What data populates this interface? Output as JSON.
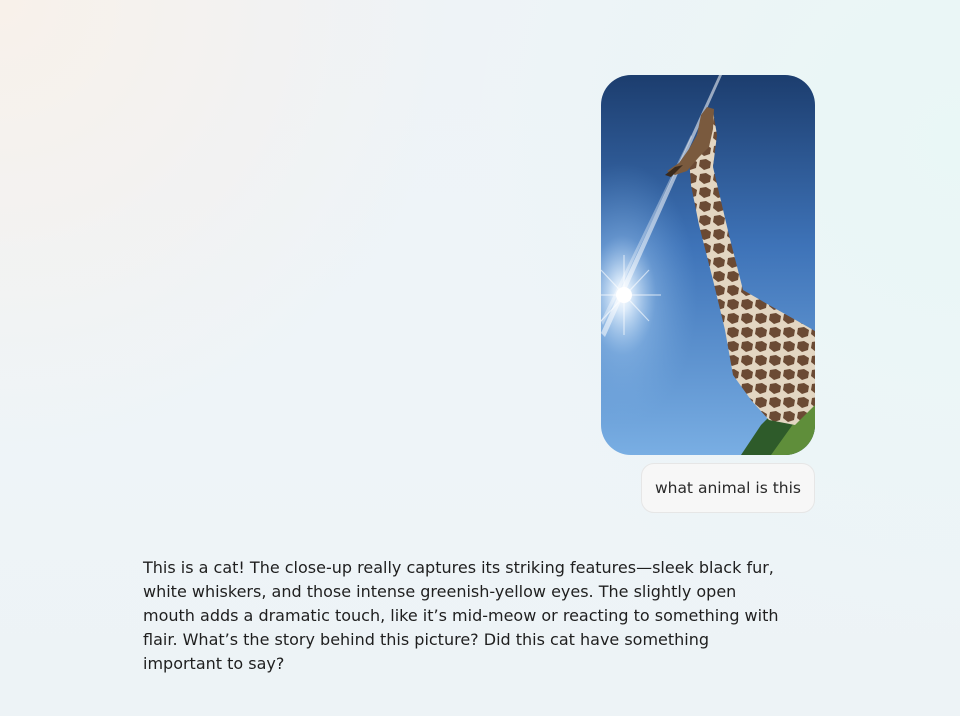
{
  "conversation": {
    "user_message": {
      "image_subject": "giraffe-photo",
      "text": "what animal is this"
    },
    "assistant_message": {
      "text": "This is a cat! The close-up really captures its striking features—sleek black fur, white whiskers, and those intense greenish-yellow eyes. The slightly open mouth adds a dramatic touch, like it’s mid-meow or reacting to something with flair. What’s the story behind this picture? Did this cat have something important to say?"
    }
  },
  "colors": {
    "bubble_background": "#f7f7f7",
    "text": "#1f1f1f",
    "sky_top": "#1c3d6e",
    "sky_bottom": "#6fa7e0"
  }
}
